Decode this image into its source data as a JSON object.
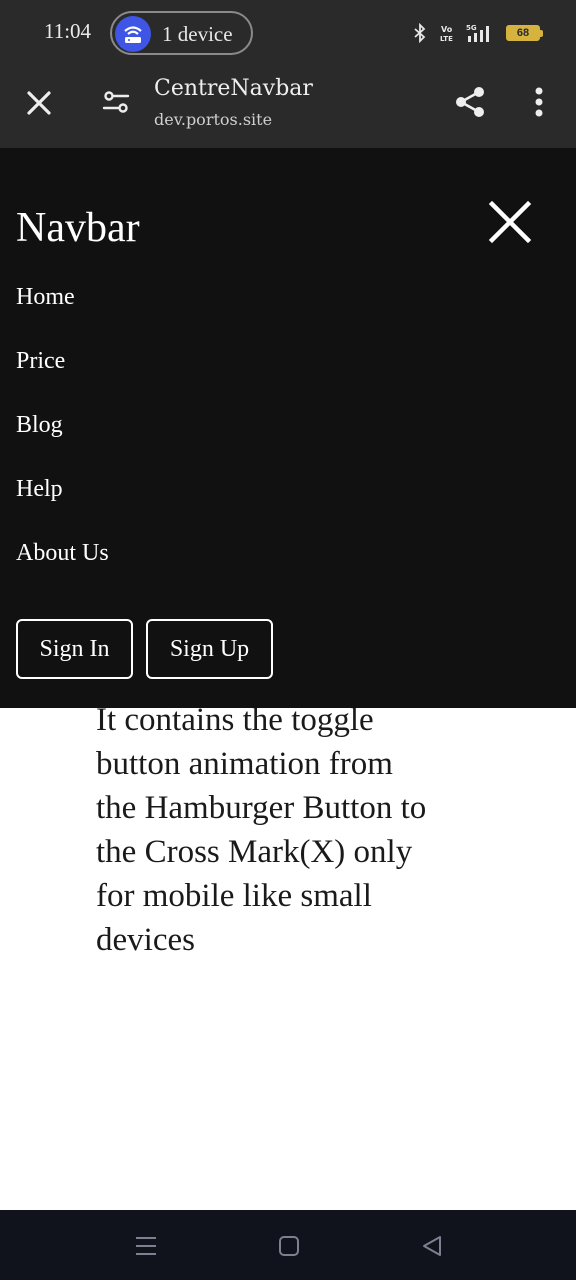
{
  "status_bar": {
    "time": "11:04",
    "hotspot_label": "1 device",
    "battery_level": "68",
    "icons": [
      "bluetooth-icon",
      "volte-icon",
      "5g-signal-icon",
      "battery-icon"
    ]
  },
  "browser": {
    "title": "CentreNavbar",
    "url": "dev.portos.site",
    "icons": [
      "close-icon",
      "site-settings-icon",
      "share-icon",
      "more-vert-icon"
    ]
  },
  "navbar": {
    "brand": "Navbar",
    "links": [
      "Home",
      "Price",
      "Blog",
      "Help",
      "About Us"
    ],
    "sign_in": "Sign In",
    "sign_up": "Sign Up",
    "background": "#111111"
  },
  "content": {
    "lines": [
      "It contains the toggle",
      "button animation from",
      "the Hamburger Button to",
      "the Cross Mark(X) only",
      "for mobile like small",
      "devices"
    ]
  },
  "system_nav": {
    "icons": [
      "recents-icon",
      "home-icon",
      "back-icon"
    ]
  },
  "colors": {
    "hotspot_accent": "#3f55e6",
    "battery": "#d6b23f"
  }
}
